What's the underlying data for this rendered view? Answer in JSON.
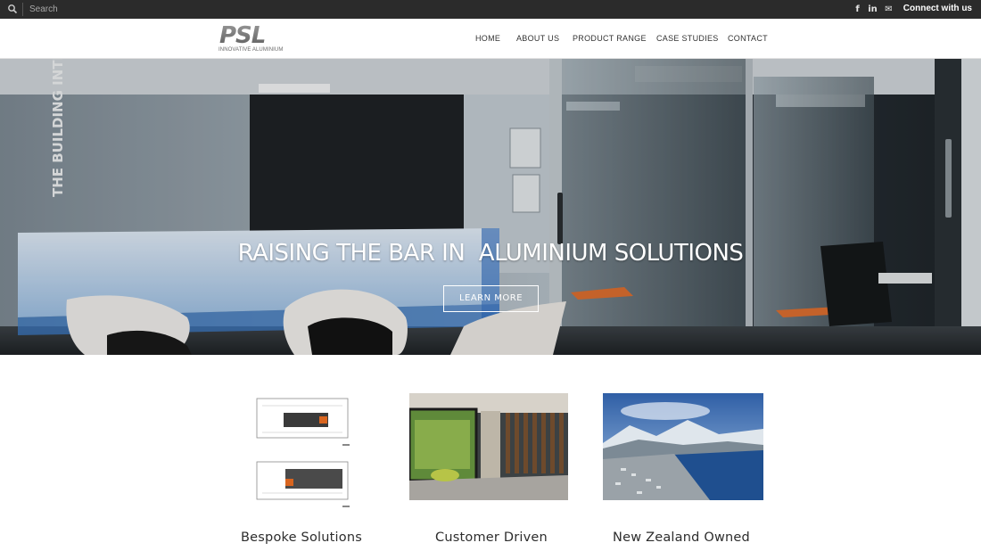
{
  "topbar": {
    "search_placeholder": "Search",
    "social": [
      {
        "icon": "facebook-icon",
        "glyph": "f"
      },
      {
        "icon": "linkedin-icon",
        "glyph": "in"
      },
      {
        "icon": "mail-icon",
        "glyph": "✉"
      }
    ],
    "connect_label": "Connect with us"
  },
  "header": {
    "logo_text": "PSL",
    "logo_tagline": "INNOVATIVE ALUMINIUM",
    "nav": [
      "HOME",
      "ABOUT US",
      "PRODUCT RANGE",
      "CASE STUDIES",
      "CONTACT"
    ]
  },
  "hero": {
    "title": "RAISING THE BAR IN  ALUMINIUM SOLUTIONS",
    "cta_label": "LEARN MORE",
    "wall_text": "THE BUILDING INTELLIGENCE GROUP"
  },
  "features": [
    {
      "caption": "Bespoke Solutions",
      "image": "floor-plan"
    },
    {
      "caption": "Customer Driven",
      "image": "glass-office-interior"
    },
    {
      "caption": "New Zealand Owned",
      "image": "lake-town-aerial"
    }
  ],
  "colors": {
    "topbar_bg": "#2b2b2b",
    "nav_text": "#333333",
    "hero_overlay": "#3a4550",
    "accent_orange": "#e07030"
  }
}
